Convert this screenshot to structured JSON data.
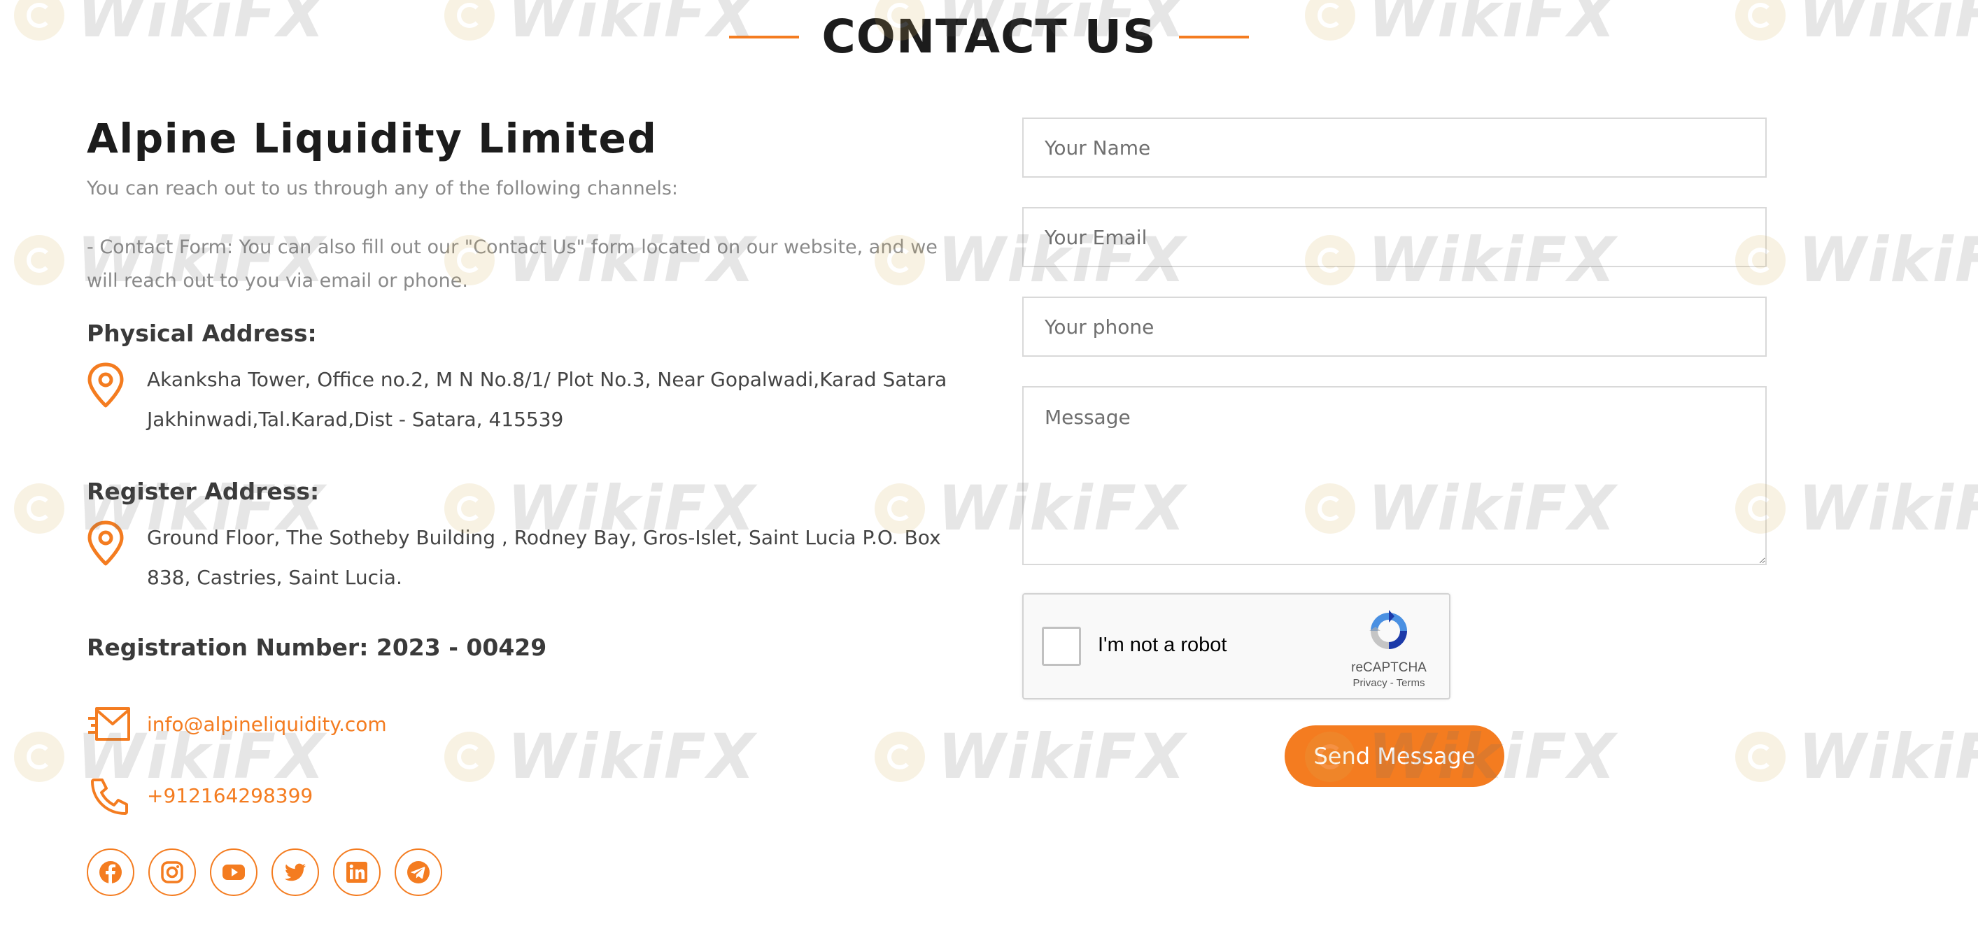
{
  "header": {
    "title": "CONTACT US"
  },
  "company": {
    "name": "Alpine Liquidity Limited",
    "intro": "You can reach out to us through any of the following channels:",
    "contact_form_note": "- Contact Form: You can also fill out our \"Contact Us\" form located on our website, and we will reach out to you via email or phone."
  },
  "physical_address": {
    "title": "Physical Address:",
    "icon": "location-pin-icon",
    "text": "Akanksha Tower, Office no.2, M N No.8/1/ Plot No.3, Near Gopalwadi,Karad Satara Jakhinwadi,Tal.Karad,Dist - Satara, 415539"
  },
  "register_address": {
    "title": "Register Address:",
    "icon": "location-pin-icon",
    "text": "Ground Floor, The Sotheby Building , Rodney Bay, Gros-Islet, Saint Lucia P.O. Box 838, Castries, Saint Lucia."
  },
  "registration": {
    "text": "Registration Number: 2023 - 00429"
  },
  "contacts": {
    "email": "info@alpineliquidity.com",
    "phone": "+912164298399"
  },
  "socials": [
    {
      "name": "facebook-icon"
    },
    {
      "name": "instagram-icon"
    },
    {
      "name": "youtube-icon"
    },
    {
      "name": "twitter-icon"
    },
    {
      "name": "linkedin-icon"
    },
    {
      "name": "telegram-icon"
    }
  ],
  "form": {
    "name_placeholder": "Your Name",
    "email_placeholder": "Your Email",
    "phone_placeholder": "Your phone",
    "message_placeholder": "Message",
    "captcha_label": "I'm not a robot",
    "captcha_brand": "reCAPTCHA",
    "captcha_terms": "Privacy - Terms",
    "send_label": "Send Message"
  },
  "watermark": {
    "text": "WikiFX"
  },
  "colors": {
    "accent": "#f47c20",
    "heading": "#1c1c1c",
    "muted_text": "#8a8a8a",
    "body_text": "#444444"
  }
}
